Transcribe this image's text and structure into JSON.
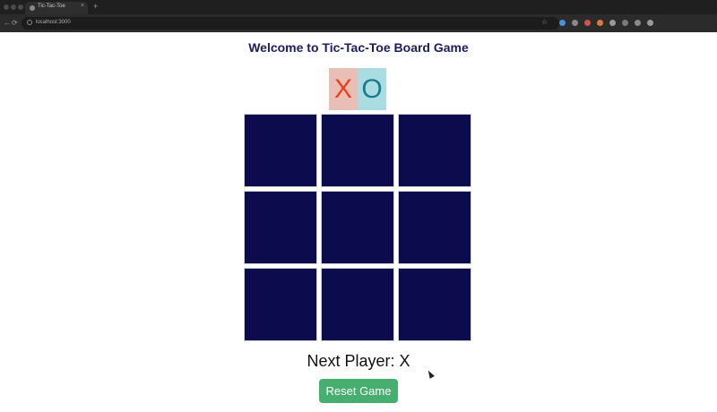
{
  "browser": {
    "tab_title": "Tic-Tac-Toe",
    "tab_close": "×",
    "new_tab": "+",
    "url": "localhost:3000",
    "back": "←",
    "forward": "→",
    "reload": "⟳",
    "star": "☆",
    "extension_colors": [
      "#4a90e2",
      "#8a8a8a",
      "#d94f4f",
      "#e07a3c",
      "#9a9a9a",
      "#7a7a7a",
      "#8a8a8a",
      "#9a9a9a"
    ]
  },
  "page": {
    "title": "Welcome to Tic-Tac-Toe Board Game",
    "symbols": {
      "x": "X",
      "o": "O",
      "x_color": "#e8401e",
      "o_color": "#1b7a8a"
    },
    "board": {
      "cells": [
        "",
        "",
        "",
        "",
        "",
        "",
        "",
        "",
        ""
      ],
      "cell_color": "#0b0b4d"
    },
    "status": "Next Player: X",
    "reset_label": "Reset Game",
    "reset_color": "#46ae6e"
  }
}
